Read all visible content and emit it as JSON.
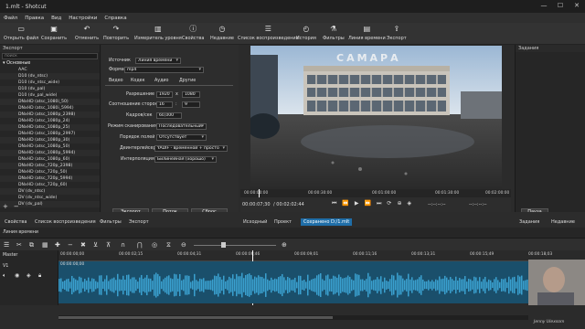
{
  "window": {
    "title": "1.mlt - Shotcut"
  },
  "menu": [
    "Файл",
    "Правка",
    "Вид",
    "Настройки",
    "Справка"
  ],
  "toolbar": {
    "open": "Открыть файл",
    "save": "Сохранить",
    "undo": "Отменить",
    "redo": "Повторить",
    "meter": "Измеритель уровня",
    "properties": "Свойства",
    "recent": "Недавние",
    "playlist": "Список воспроизведения",
    "history": "История",
    "filters": "Фильтры",
    "timeline": "Линия времени",
    "export": "Экспорт"
  },
  "export_panel": {
    "header": "Экспорт",
    "search_placeholder": "поиск",
    "group": "Основные",
    "presets": [
      "AAC",
      "D10 (dv_ntsc)",
      "D10 (dv_ntsc_wide)",
      "D10 (dv_pal)",
      "D10 (dv_pal_wide)",
      "DNxHD (atsc_1080i_50)",
      "DNxHD (atsc_1080i_5994)",
      "DNxHD (atsc_1080p_2398)",
      "DNxHD (atsc_1080p_24)",
      "DNxHD (atsc_1080p_25)",
      "DNxHD (atsc_1080p_2997)",
      "DNxHD (atsc_1080p_30)",
      "DNxHD (atsc_1080p_50)",
      "DNxHD (atsc_1080p_5994)",
      "DNxHD (atsc_1080p_60)",
      "DNxHD (atsc_720p_2398)",
      "DNxHD (atsc_720p_50)",
      "DNxHD (atsc_720p_5994)",
      "DNxHD (atsc_720p_60)",
      "DV (dv_ntsc)",
      "DV (dv_ntsc_wide)",
      "DV (dv_pal)"
    ],
    "add_icon": "+",
    "remove_icon": "−",
    "source_label": "Источник",
    "source_value": "Линия времени",
    "format_label": "Формат",
    "format_value": "mp4",
    "subtabs": [
      "Видео",
      "Кодек",
      "Аудио",
      "Другие"
    ],
    "resolution_label": "Разрешение",
    "res_w": "1920",
    "res_x": "x",
    "res_h": "1080",
    "aspect_label": "Соотношение сторон",
    "aspect_w": "16",
    "aspect_h": "9",
    "fps_label": "Кадров/сек",
    "fps_value": "60,000",
    "scan_label": "Режим сканирования",
    "scan_value": "Последовательный",
    "field_order_label": "Порядок полей",
    "field_order_value": "Отсутствует",
    "deinterlacer_label": "Деинтерлейсер",
    "deinterlacer_value": "YADIF - временной + просто",
    "interp_label": "Интерполяция",
    "interp_value": "Билинейная (хорошо)",
    "btn_export": "Экспорт",
    "btn_stream": "Поток",
    "btn_reset": "Сброс"
  },
  "video": {
    "sign_text": "САМАРА",
    "ruler_ticks": [
      "00:00:00:00",
      "00:00:30:00",
      "00:01:00:00",
      "00:01:30:00",
      "00:02:00:00"
    ],
    "current_time": "00:00:07;30",
    "total_time": "/ 00:02:02:44",
    "in_point": "--:--:--:--",
    "out_point": "--:--:--:--"
  },
  "tasks_panel": {
    "header": "Задания",
    "pause_btn": "Пауза",
    "btn2": "Вы",
    "btn3": "Ис"
  },
  "bottom_tabs": {
    "left": [
      "Свойства",
      "Список воспроизведения",
      "Фильтры",
      "Экспорт"
    ],
    "source": "Исходный",
    "project": "Проект",
    "saved": "Сохранено D:/1.mlt",
    "tasks_left": "Задания",
    "tasks_right": "Недавние"
  },
  "timeline": {
    "header": "Линия времени",
    "master": "Master",
    "track": "V1",
    "ticks": [
      "00:00:00;00",
      "00:00:02;15",
      "00:00:04;31",
      "00:00:06;46",
      "00:00:09;01",
      "00:00:11;16",
      "00:00:13;31",
      "00:00:15;49",
      "00:00:18;03"
    ],
    "clip_name": "00:00:00;00"
  },
  "watermark": "Jenny Ulexsom"
}
